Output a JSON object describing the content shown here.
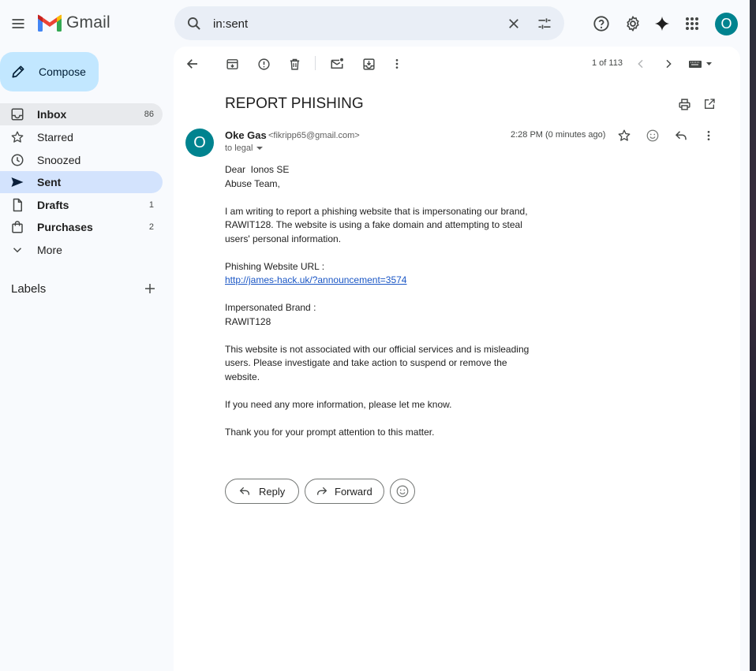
{
  "app": {
    "name": "Gmail"
  },
  "search": {
    "value": "in:sent"
  },
  "header": {
    "avatar_letter": "O"
  },
  "compose": {
    "label": "Compose"
  },
  "nav": [
    {
      "label": "Inbox",
      "count": "86"
    },
    {
      "label": "Starred",
      "count": ""
    },
    {
      "label": "Snoozed",
      "count": ""
    },
    {
      "label": "Sent",
      "count": ""
    },
    {
      "label": "Drafts",
      "count": "1"
    },
    {
      "label": "Purchases",
      "count": "2"
    },
    {
      "label": "More",
      "count": ""
    }
  ],
  "labels": {
    "title": "Labels"
  },
  "toolbar": {
    "page_count": "1 of 113"
  },
  "email": {
    "subject": "REPORT PHISHING",
    "sender_avatar": "O",
    "sender_name": "Oke Gas",
    "sender_email": "<fikripp65@gmail.com>",
    "to": "to legal",
    "timestamp": "2:28 PM (0 minutes ago)",
    "body": {
      "greeting_1": "Dear  Ionos SE",
      "greeting_2": "Abuse Team,",
      "para_1": "I am writing to report a phishing website that is impersonating our brand, RAWIT128. The website is using a fake domain and attempting to steal users' personal information.",
      "url_label": "Phishing Website URL :",
      "url": "http://james-hack.uk/?announcement=3574",
      "brand_label": "Impersonated Brand :",
      "brand": "RAWIT128",
      "para_2": "This website is not associated with our official services and is misleading users. Please investigate and take action to suspend or remove the website.",
      "para_3": "If you need any more information, please let me know.",
      "para_4": "Thank you for your prompt attention to this matter."
    }
  },
  "actions": {
    "reply_label": "Reply",
    "forward_label": "Forward"
  },
  "colors": {
    "accent": "#c2e7ff",
    "selected_nav": "#d3e3fd",
    "avatar": "#00838f",
    "link": "#1a56c5"
  }
}
